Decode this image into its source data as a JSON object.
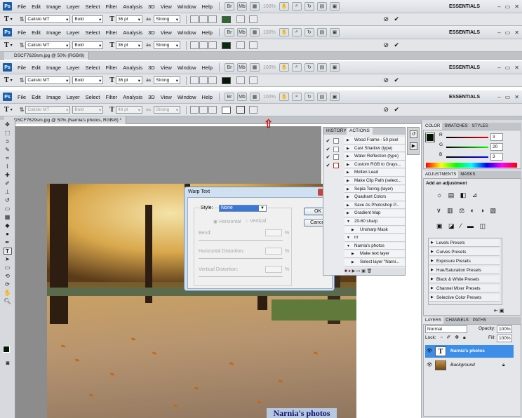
{
  "app": {
    "logo": "Ps",
    "essentials": "ESSENTIALS",
    "zoom": "100%"
  },
  "menu": [
    "File",
    "Edit",
    "Image",
    "Layer",
    "Select",
    "Filter",
    "Analysis",
    "3D",
    "View",
    "Window",
    "Help"
  ],
  "options_bars": [
    {
      "font": "Calisto MT",
      "style": "Bold",
      "size": "36 pt",
      "aa": "Strong",
      "color": "#2a6a2f"
    },
    {
      "font": "Calisto MT",
      "style": "Bold",
      "size": "36 pt",
      "aa": "Strong",
      "color": "#0c2a10"
    },
    {
      "font": "Calisto MT",
      "style": "Bold",
      "size": "36 pt",
      "aa": "Strong",
      "color": "#06160a"
    },
    {
      "font": "Calisto MT",
      "style": "Bold",
      "size": "48 pt",
      "aa": "Strong",
      "color": "#ffffff"
    }
  ],
  "doc_tabs": [
    "DSCF7629sm.jpg @ 50% (RGB/8)",
    "DSCF7629sm.jpg @ 50% (RGB/8)",
    "DSCF7629sm.jpg @ 50% (Narnia's photos, RGB/8) *"
  ],
  "canvas": {
    "caption": "Narnia's photos"
  },
  "dialog": {
    "title": "Warp Text",
    "style_label": "Style:",
    "style_value": "None",
    "horizontal": "Horizontal",
    "vertical": "Vertical",
    "bend": "Bend:",
    "h_distortion": "Horizontal Distortion:",
    "v_distortion": "Vertical Distortion:",
    "percent": "%",
    "ok": "OK",
    "cancel": "Cancel"
  },
  "history_panel": {
    "tabs": [
      "HISTORY",
      "ACTIONS"
    ],
    "actions": [
      "Wood Frame - 50 pixel",
      "Cast Shadow (type)",
      "Water Reflection (type)",
      "Custom RGB to Grays...",
      "Molten Lead",
      "Make Clip Path (select...",
      "Sepia Toning (layer)",
      "Quadrant Colors",
      "Save As Photoshop P...",
      "Gradient Map",
      "20-60 sharp",
      "Unsharp Mask",
      "nr",
      "Narnia's photos",
      "Make text layer",
      "Select layer \"Narni..."
    ]
  },
  "color_panel": {
    "tabs": [
      "COLOR",
      "SWATCHES",
      "STYLES"
    ],
    "r_label": "R",
    "g_label": "G",
    "b_label": "B",
    "r": "3",
    "g": "20",
    "b": "3"
  },
  "adjustments": {
    "tabs": [
      "ADJUSTMENTS",
      "MASKS"
    ],
    "heading": "Add an adjustment",
    "presets": [
      "Levels Presets",
      "Curves Presets",
      "Exposure Presets",
      "Hue/Saturation Presets",
      "Black & White Presets",
      "Channel Mixer Presets",
      "Selective Color Presets"
    ]
  },
  "layers": {
    "tabs": [
      "LAYERS",
      "CHANNELS",
      "PATHS"
    ],
    "blend_mode": "Normal",
    "opacity_label": "Opacity:",
    "opacity": "100%",
    "lock_label": "Lock:",
    "fill_label": "Fill:",
    "fill": "100%",
    "items": [
      {
        "name": "Narnia's photos",
        "thumb": "T"
      },
      {
        "name": "Background",
        "thumb": ""
      }
    ]
  }
}
